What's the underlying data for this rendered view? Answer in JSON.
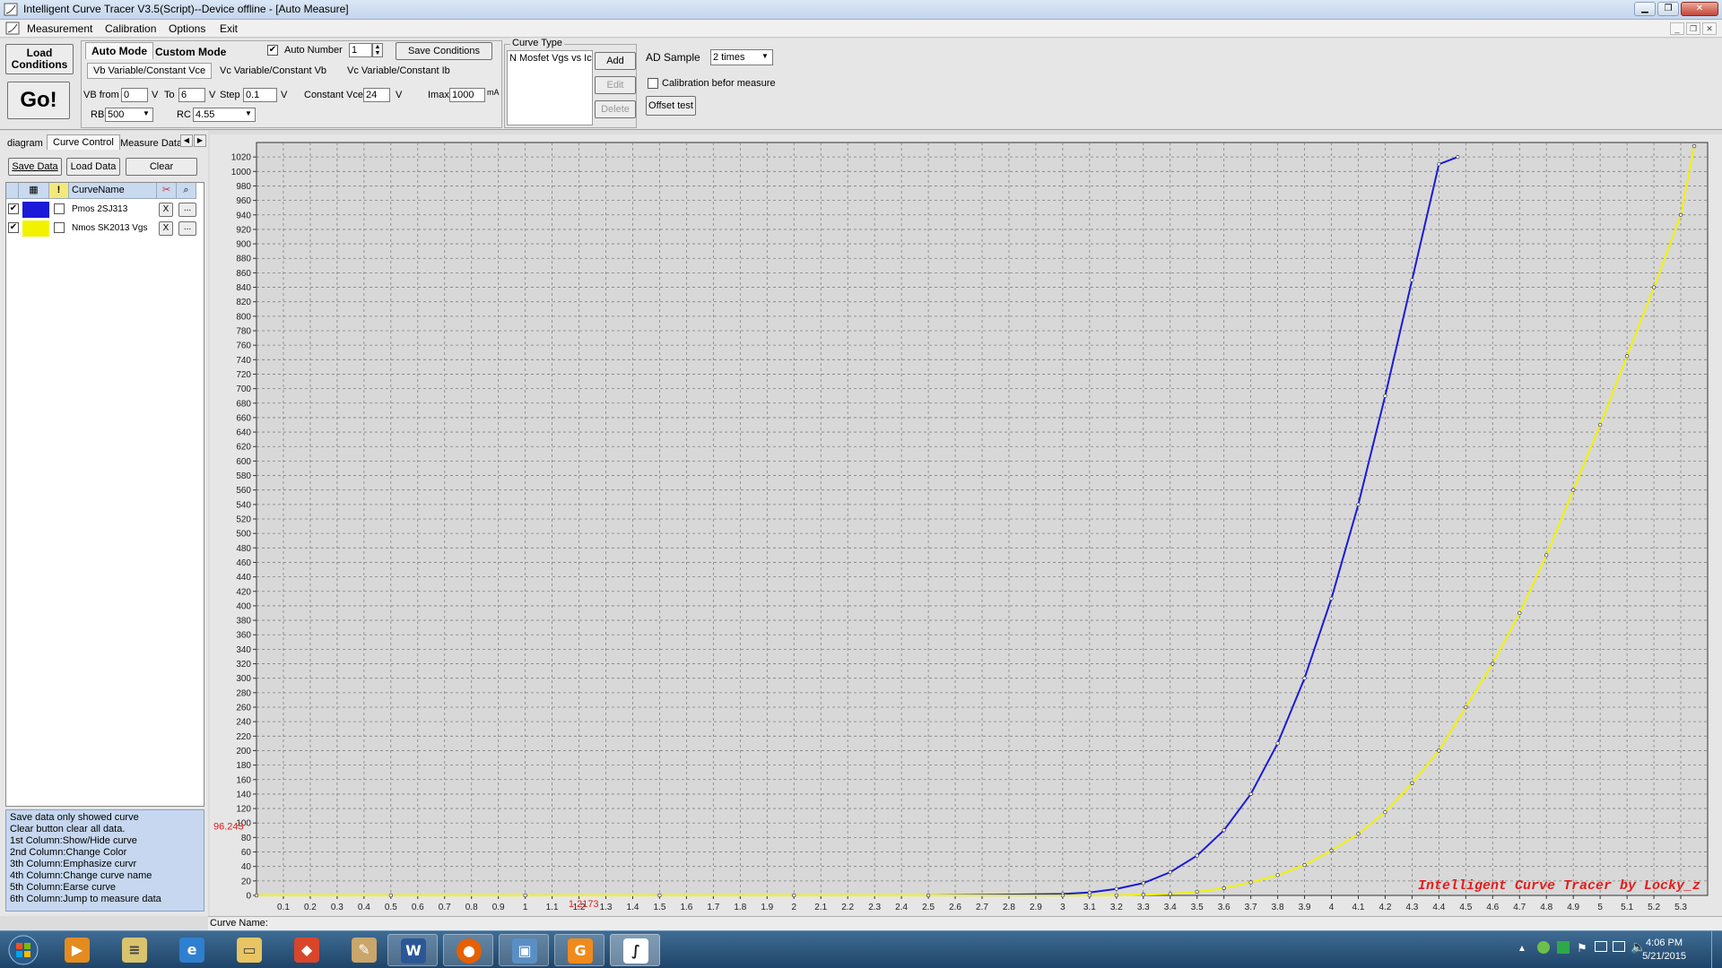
{
  "window": {
    "title": "Intelligent Curve Tracer V3.5(Script)--Device offline - [Auto Measure]"
  },
  "menu": [
    "Measurement",
    "Calibration",
    "Options",
    "Exit"
  ],
  "toolbar": {
    "load_conditions": "Load Conditions",
    "go": "Go!",
    "mode_tabs": [
      "Auto Mode",
      "Custom Mode"
    ],
    "auto_number_label": "Auto Number",
    "auto_number_checked": true,
    "auto_number_value": "1",
    "save_conditions": "Save Conditions",
    "sub_tabs": [
      "Vb Variable/Constant Vce",
      "Vc Variable/Constant Vb",
      "Vc Variable/Constant Ib"
    ],
    "vb_from_label": "VB from",
    "vb_from_value": "0",
    "v_unit": "V",
    "to_label": "To",
    "to_value": "6",
    "step_label": "Step",
    "step_value": "0.1",
    "constant_vce_label": "Constant Vce",
    "constant_vce_value": "24",
    "imax_label": "Imax",
    "imax_value": "1000",
    "imax_unit": "mA",
    "rb_label": "RB",
    "rb_value": "500",
    "rc_label": "RC",
    "rc_value": "4.55",
    "curve_type_label": "Curve Type",
    "curve_type_item": "N Mosfet Vgs vs Ic",
    "add": "Add",
    "edit": "Edit",
    "delete": "Delete",
    "ad_sample_label": "AD Sample",
    "ad_sample_value": "2 times",
    "calibration_label": "Calibration befor measure",
    "calibration_checked": false,
    "offset_test": "Offset test"
  },
  "left_panel": {
    "tabs": [
      "diagram",
      "Curve Control",
      "Measure Data"
    ],
    "save_data": "Save Data",
    "load_data": "Load Data",
    "clear": "Clear",
    "column_header": "CurveName",
    "curves": [
      {
        "name": "Pmos 2SJ313",
        "color": "#1a1ad8",
        "visible": true,
        "erase": "X",
        "jump": "..."
      },
      {
        "name": "Nmos SK2013 Vgs",
        "color": "#f2f200",
        "visible": true,
        "erase": "X",
        "jump": "..."
      }
    ],
    "help_lines": [
      " Save data only showed curve",
      " Clear button clear all data.",
      "1st Column:Show/Hide curve",
      "2nd Column:Change Color",
      "3th Column:Emphasize curvr",
      "4th Column:Change curve name",
      "5th Column:Earse curve",
      "6th Column:Jump to measure data"
    ]
  },
  "status": {
    "curve_name_label": "Curve Name:"
  },
  "chart_data": {
    "type": "line",
    "watermark": "Intelligent Curve Tracer by Locky_z",
    "cursor_y_readout": "96.243",
    "cursor_x_readout": "1.2173",
    "xlim": [
      0,
      5.4
    ],
    "ylim": [
      0,
      1040
    ],
    "x_ticks": [
      "0.1",
      "0.2",
      "0.3",
      "0.4",
      "0.5",
      "0.6",
      "0.7",
      "0.8",
      "0.9",
      "1",
      "1.1",
      "1.2",
      "1.3",
      "1.4",
      "1.5",
      "1.6",
      "1.7",
      "1.8",
      "1.9",
      "2",
      "2.1",
      "2.2",
      "2.3",
      "2.4",
      "2.5",
      "2.6",
      "2.7",
      "2.8",
      "2.9",
      "3",
      "3.1",
      "3.2",
      "3.3",
      "3.4",
      "3.5",
      "3.6",
      "3.7",
      "3.8",
      "3.9",
      "4",
      "4.1",
      "4.2",
      "4.3",
      "4.4",
      "4.5",
      "4.6",
      "4.7",
      "4.8",
      "4.9",
      "5",
      "5.1",
      "5.2",
      "5.3"
    ],
    "y_ticks": [
      0,
      20,
      40,
      60,
      80,
      100,
      120,
      140,
      160,
      180,
      200,
      220,
      240,
      260,
      280,
      300,
      320,
      340,
      360,
      380,
      400,
      420,
      440,
      460,
      480,
      500,
      520,
      540,
      560,
      580,
      600,
      620,
      640,
      660,
      680,
      700,
      720,
      740,
      760,
      780,
      800,
      820,
      840,
      860,
      880,
      900,
      920,
      940,
      960,
      980,
      1000,
      1020
    ],
    "grid": true,
    "series": [
      {
        "name": "Pmos 2SJ313",
        "color": "#1a1ad8",
        "x": [
          0.0,
          0.5,
          1.0,
          1.5,
          2.0,
          2.5,
          3.0,
          3.1,
          3.2,
          3.3,
          3.4,
          3.5,
          3.6,
          3.7,
          3.8,
          3.9,
          4.0,
          4.1,
          4.2,
          4.3,
          4.4,
          4.47
        ],
        "y": [
          0,
          0,
          0,
          0,
          0,
          0,
          2,
          4,
          9,
          17,
          32,
          55,
          90,
          140,
          210,
          300,
          410,
          540,
          690,
          850,
          1010,
          1020
        ]
      },
      {
        "name": "Nmos SK2013 Vgs",
        "color": "#f2f200",
        "x": [
          0.0,
          0.5,
          1.0,
          1.5,
          2.0,
          2.5,
          3.0,
          3.1,
          3.2,
          3.3,
          3.4,
          3.5,
          3.6,
          3.7,
          3.8,
          3.9,
          4.0,
          4.1,
          4.2,
          4.3,
          4.4,
          4.5,
          4.6,
          4.7,
          4.8,
          4.9,
          5.0,
          5.1,
          5.2,
          5.3,
          5.35
        ],
        "y": [
          0,
          0,
          0,
          0,
          0,
          0,
          0,
          0,
          0,
          1,
          2,
          5,
          10,
          18,
          28,
          42,
          62,
          85,
          115,
          155,
          200,
          260,
          320,
          390,
          470,
          560,
          650,
          745,
          840,
          940,
          1035
        ]
      }
    ]
  }
}
